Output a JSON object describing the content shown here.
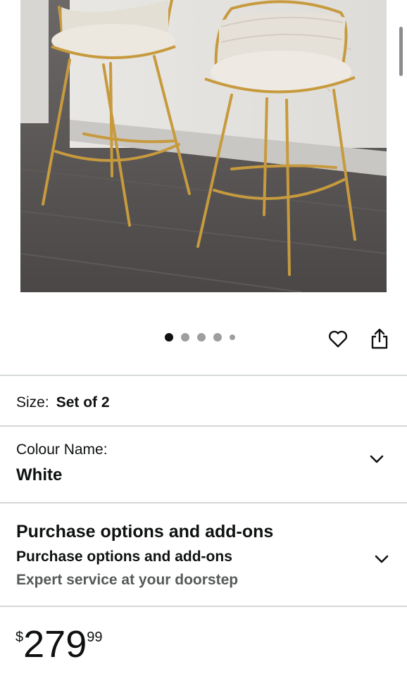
{
  "product_image": {
    "alt": "Two white woven-back bar stools with gold metal legs"
  },
  "carousel": {
    "count": 5,
    "active": 0
  },
  "actions": {
    "wishlist_icon": "heart-icon",
    "share_icon": "share-icon"
  },
  "size": {
    "label": "Size:",
    "value": "Set of 2"
  },
  "colour": {
    "label": "Colour Name:",
    "value": "White",
    "icon": "chevron-down-icon"
  },
  "purchase": {
    "title": "Purchase options and add-ons",
    "subtitle": "Purchase options and add-ons",
    "note": "Expert service at your doorstep",
    "icon": "chevron-down-icon"
  },
  "price": {
    "symbol": "$",
    "whole": "279",
    "fraction": "99"
  }
}
